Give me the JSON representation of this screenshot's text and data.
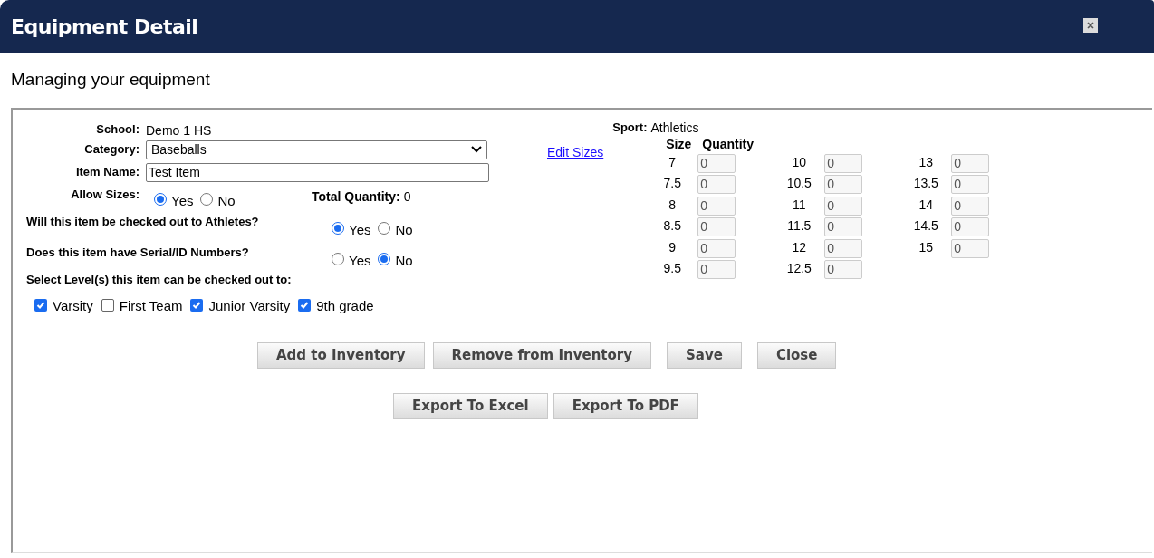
{
  "window": {
    "title": "Equipment Detail"
  },
  "subtitle": "Managing your equipment",
  "form": {
    "school": {
      "label": "School:",
      "value": "Demo 1 HS"
    },
    "category": {
      "label": "Category:",
      "value": "Baseballs"
    },
    "item_name": {
      "label": "Item Name:",
      "value": "Test Item"
    },
    "allow_sizes": {
      "label": "Allow Sizes:",
      "options": [
        {
          "label": "Yes",
          "selected": true
        },
        {
          "label": "No",
          "selected": false
        }
      ]
    },
    "total_quantity": {
      "label": "Total Quantity:",
      "value": "0"
    },
    "questions": [
      {
        "label": "Will this item be checked out to Athletes?",
        "options": [
          {
            "label": "Yes",
            "selected": true
          },
          {
            "label": "No",
            "selected": false
          }
        ]
      },
      {
        "label": "Does this item have Serial/ID Numbers?",
        "options": [
          {
            "label": "Yes",
            "selected": false
          },
          {
            "label": "No",
            "selected": true
          }
        ]
      }
    ],
    "levels_label": "Select Level(s) this item can be checked out to:",
    "levels": [
      {
        "label": "Varsity",
        "checked": true
      },
      {
        "label": "First Team",
        "checked": false
      },
      {
        "label": "Junior Varsity",
        "checked": true
      },
      {
        "label": "9th grade",
        "checked": true
      }
    ]
  },
  "edit_sizes_link": "Edit Sizes",
  "sport": {
    "label": "Sport:",
    "value": "Athletics"
  },
  "sizes": {
    "columns": [
      "Size",
      "Quantity"
    ],
    "columns_of_rows": [
      [
        {
          "size": "7",
          "quantity": "0"
        },
        {
          "size": "7.5",
          "quantity": "0"
        },
        {
          "size": "8",
          "quantity": "0"
        },
        {
          "size": "8.5",
          "quantity": "0"
        },
        {
          "size": "9",
          "quantity": "0"
        },
        {
          "size": "9.5",
          "quantity": "0"
        }
      ],
      [
        {
          "size": "10",
          "quantity": "0"
        },
        {
          "size": "10.5",
          "quantity": "0"
        },
        {
          "size": "11",
          "quantity": "0"
        },
        {
          "size": "11.5",
          "quantity": "0"
        },
        {
          "size": "12",
          "quantity": "0"
        },
        {
          "size": "12.5",
          "quantity": "0"
        }
      ],
      [
        {
          "size": "13",
          "quantity": "0"
        },
        {
          "size": "13.5",
          "quantity": "0"
        },
        {
          "size": "14",
          "quantity": "0"
        },
        {
          "size": "14.5",
          "quantity": "0"
        },
        {
          "size": "15",
          "quantity": "0"
        }
      ]
    ]
  },
  "buttons": [
    "Add to Inventory",
    "Remove from Inventory",
    "Save",
    "Close"
  ],
  "export_buttons": [
    "Export To Excel",
    "Export To PDF"
  ]
}
